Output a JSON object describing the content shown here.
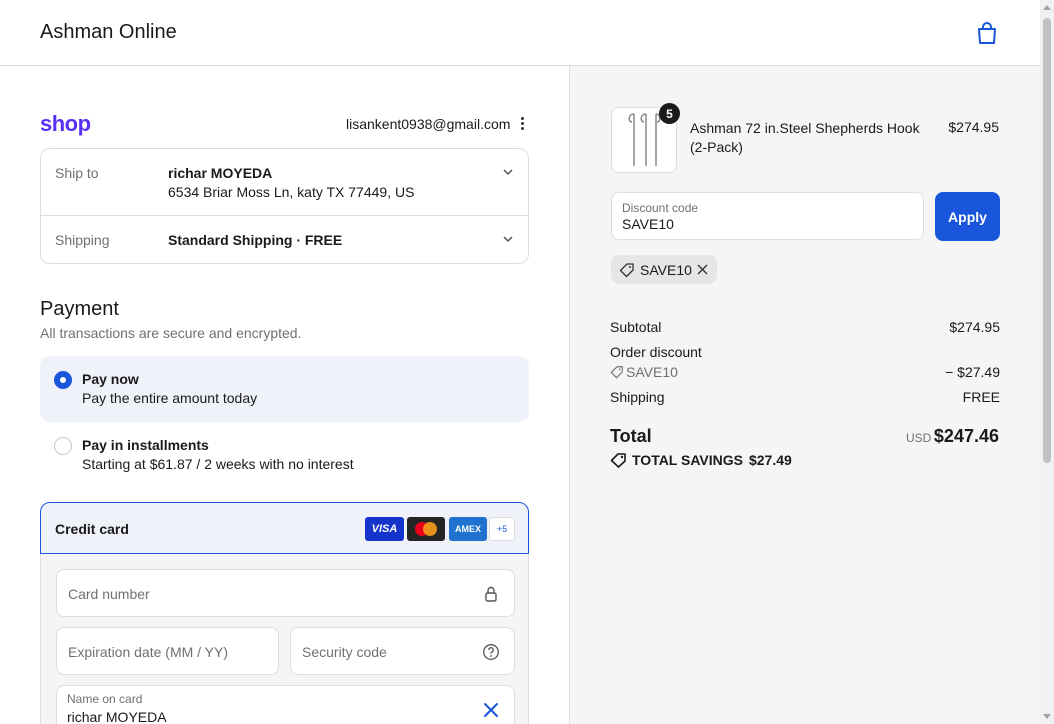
{
  "header": {
    "store_name": "Ashman Online",
    "cart_icon": "shopping-bag-icon"
  },
  "account": {
    "logo": "shop",
    "email": "lisankent0938@gmail.com"
  },
  "shipping": {
    "ship_to_label": "Ship to",
    "recipient_name": "richar MOYEDA",
    "address": "6534 Briar Moss Ln, katy TX 77449, US",
    "shipping_label": "Shipping",
    "method": "Standard Shipping · FREE"
  },
  "payment": {
    "title": "Payment",
    "subtitle": "All transactions are secure and encrypted.",
    "options": [
      {
        "title": "Pay now",
        "desc": "Pay the entire amount today",
        "selected": true
      },
      {
        "title": "Pay in installments",
        "desc": "Starting at $61.87 / 2 weeks with no interest",
        "selected": false
      }
    ],
    "credit_card": {
      "title": "Credit card",
      "brands": [
        "VISA",
        "Mastercard",
        "AMEX"
      ],
      "more_brands": "+5",
      "card_number_placeholder": "Card number",
      "expiration_placeholder": "Expiration date (MM / YY)",
      "security_placeholder": "Security code",
      "name_label": "Name on card",
      "name_value": "richar MOYEDA"
    }
  },
  "summary": {
    "product": {
      "quantity": "5",
      "name": "Ashman 72 in.Steel Shepherds Hook (2-Pack)",
      "price": "$274.95"
    },
    "discount_field": {
      "label": "Discount code",
      "value": "SAVE10"
    },
    "apply_label": "Apply",
    "applied_code": "SAVE10",
    "subtotal_label": "Subtotal",
    "subtotal_value": "$274.95",
    "order_discount_label": "Order discount",
    "discount_code": "SAVE10",
    "discount_value": "− $27.49",
    "shipping_label": "Shipping",
    "shipping_value": "FREE",
    "total_label": "Total",
    "currency": "USD",
    "total_value": "$247.46",
    "savings_label": "TOTAL SAVINGS",
    "savings_value": "$27.49"
  },
  "colors": {
    "accent": "#1a56db",
    "shop_brand": "#5a31f4"
  }
}
